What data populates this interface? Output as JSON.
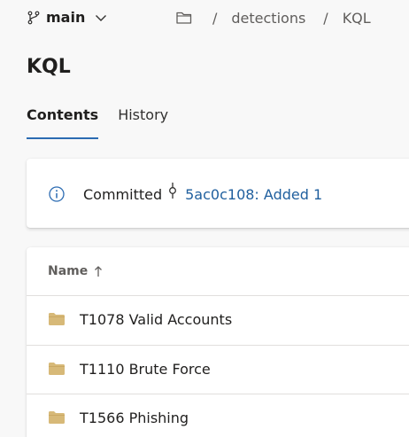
{
  "header": {
    "branch_name": "main",
    "breadcrumb": [
      "detections",
      "KQL"
    ],
    "separator": "/"
  },
  "page_title": "KQL",
  "tabs": [
    {
      "label": "Contents",
      "active": true
    },
    {
      "label": "History",
      "active": false
    }
  ],
  "commit": {
    "label": "Committed",
    "link_text": "5ac0c108: Added 1"
  },
  "files": {
    "column_header": "Name",
    "sort": "ascending",
    "rows": [
      {
        "name": "T1078 Valid Accounts",
        "icon": "folder-icon"
      },
      {
        "name": "T1110 Brute Force",
        "icon": "folder-icon"
      },
      {
        "name": "T1566 Phishing",
        "icon": "folder-icon"
      }
    ]
  },
  "colors": {
    "accent": "#2b6bb2",
    "link": "#1f5f9e",
    "folder": "#d7b978"
  }
}
